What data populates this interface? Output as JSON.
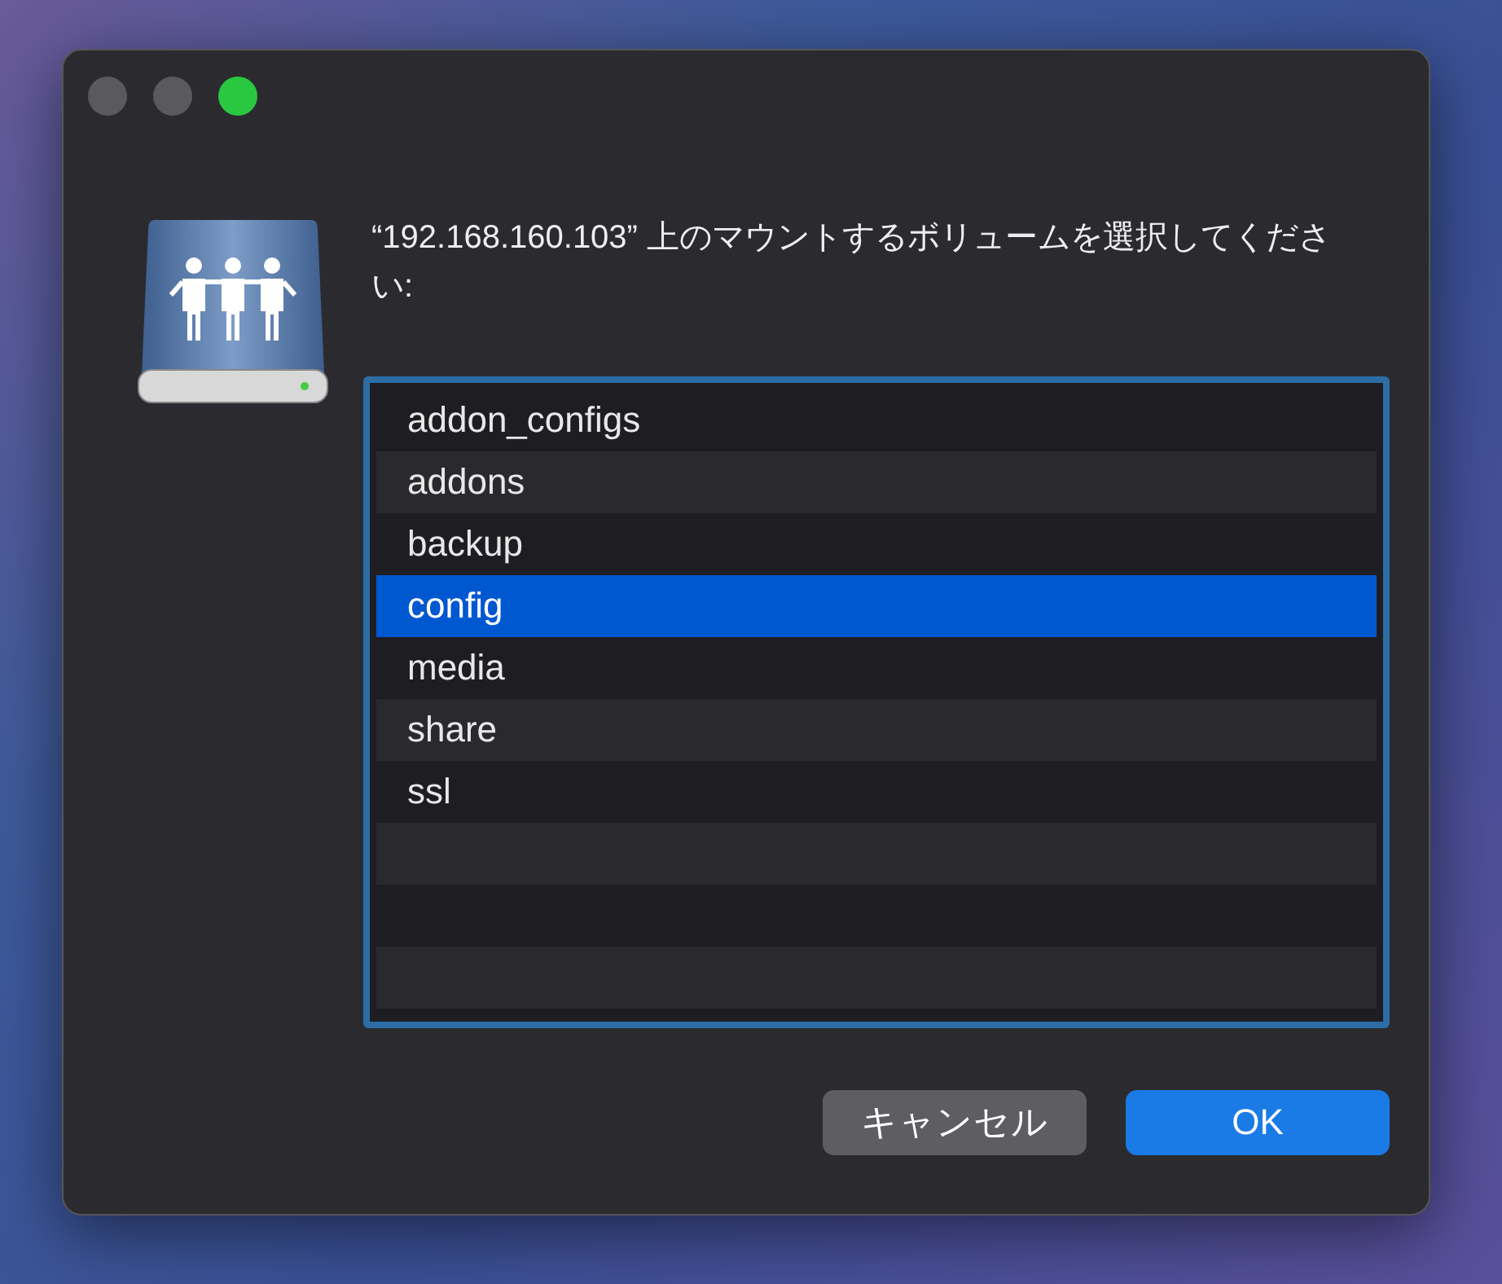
{
  "window": {
    "traffic_lights": [
      {
        "kind": "close",
        "disabled": true
      },
      {
        "kind": "minimize",
        "disabled": true
      },
      {
        "kind": "zoom",
        "disabled": false
      }
    ]
  },
  "message": "“192.168.160.103” 上のマウントするボリュームを選択してください:",
  "volumes": [
    {
      "name": "addon_configs",
      "selected": false
    },
    {
      "name": "addons",
      "selected": false
    },
    {
      "name": "backup",
      "selected": false
    },
    {
      "name": "config",
      "selected": true
    },
    {
      "name": "media",
      "selected": false
    },
    {
      "name": "share",
      "selected": false
    },
    {
      "name": "ssl",
      "selected": false
    }
  ],
  "buttons": [
    {
      "label": "キャンセル",
      "kind": "secondary"
    },
    {
      "label": "OK",
      "kind": "primary"
    }
  ]
}
